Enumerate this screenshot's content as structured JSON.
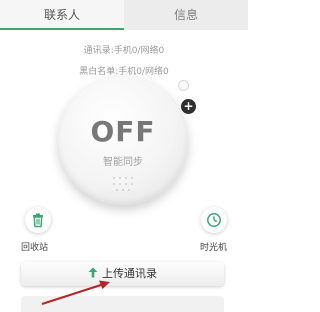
{
  "tabs": [
    {
      "label": "联系人",
      "active": true
    },
    {
      "label": "信息",
      "active": false
    }
  ],
  "stats": {
    "contacts_line": "通讯录:手机0/网络0",
    "blacklist_line": "黑白名单:手机0/网络0"
  },
  "sync": {
    "state": "OFF",
    "label": "智能同步"
  },
  "actions": {
    "recycle_label": "回收站",
    "timemachine_label": "时光机",
    "upload_label": "上传通讯录"
  },
  "colors": {
    "accent": "#3aa773",
    "annotation_arrow": "#b3262b"
  },
  "icons": {
    "plus": "+",
    "recycle": "trash-icon",
    "timemachine": "clock-icon",
    "upload": "up-arrow-icon"
  }
}
